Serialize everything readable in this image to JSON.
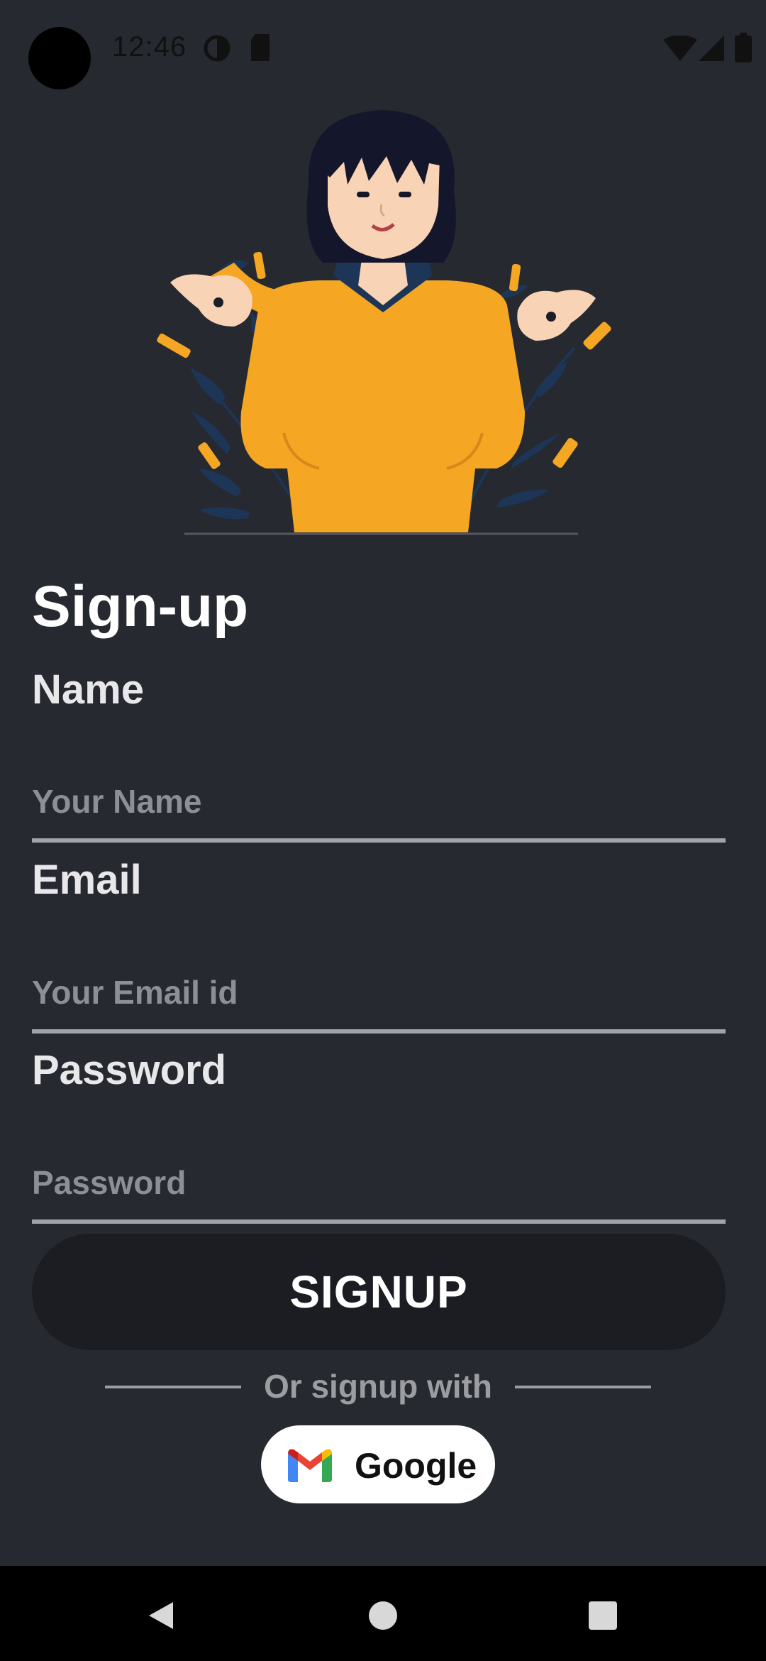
{
  "status_bar": {
    "time": "12:46",
    "icons": [
      "camera-cutout",
      "data-saver-icon",
      "sd-card-icon",
      "wifi-icon",
      "signal-icon",
      "battery-icon"
    ]
  },
  "page": {
    "title": "Sign-up"
  },
  "form": {
    "name_label": "Name",
    "name_placeholder": "Your Name",
    "name_value": "",
    "email_label": "Email",
    "email_placeholder": "Your Email id",
    "email_value": "",
    "password_label": "Password",
    "password_placeholder": "Password",
    "password_value": ""
  },
  "actions": {
    "signup_label": "SIGNUP",
    "divider_text": "Or signup with",
    "google_label": "Google"
  },
  "nav": {
    "icons": [
      "back-icon",
      "home-icon",
      "recents-icon"
    ]
  },
  "colors": {
    "background": "#262930",
    "button": "#1b1d22",
    "underline": "#a3a3a7",
    "illustration_accent": "#f5a623",
    "illustration_navy": "#1d3557"
  }
}
